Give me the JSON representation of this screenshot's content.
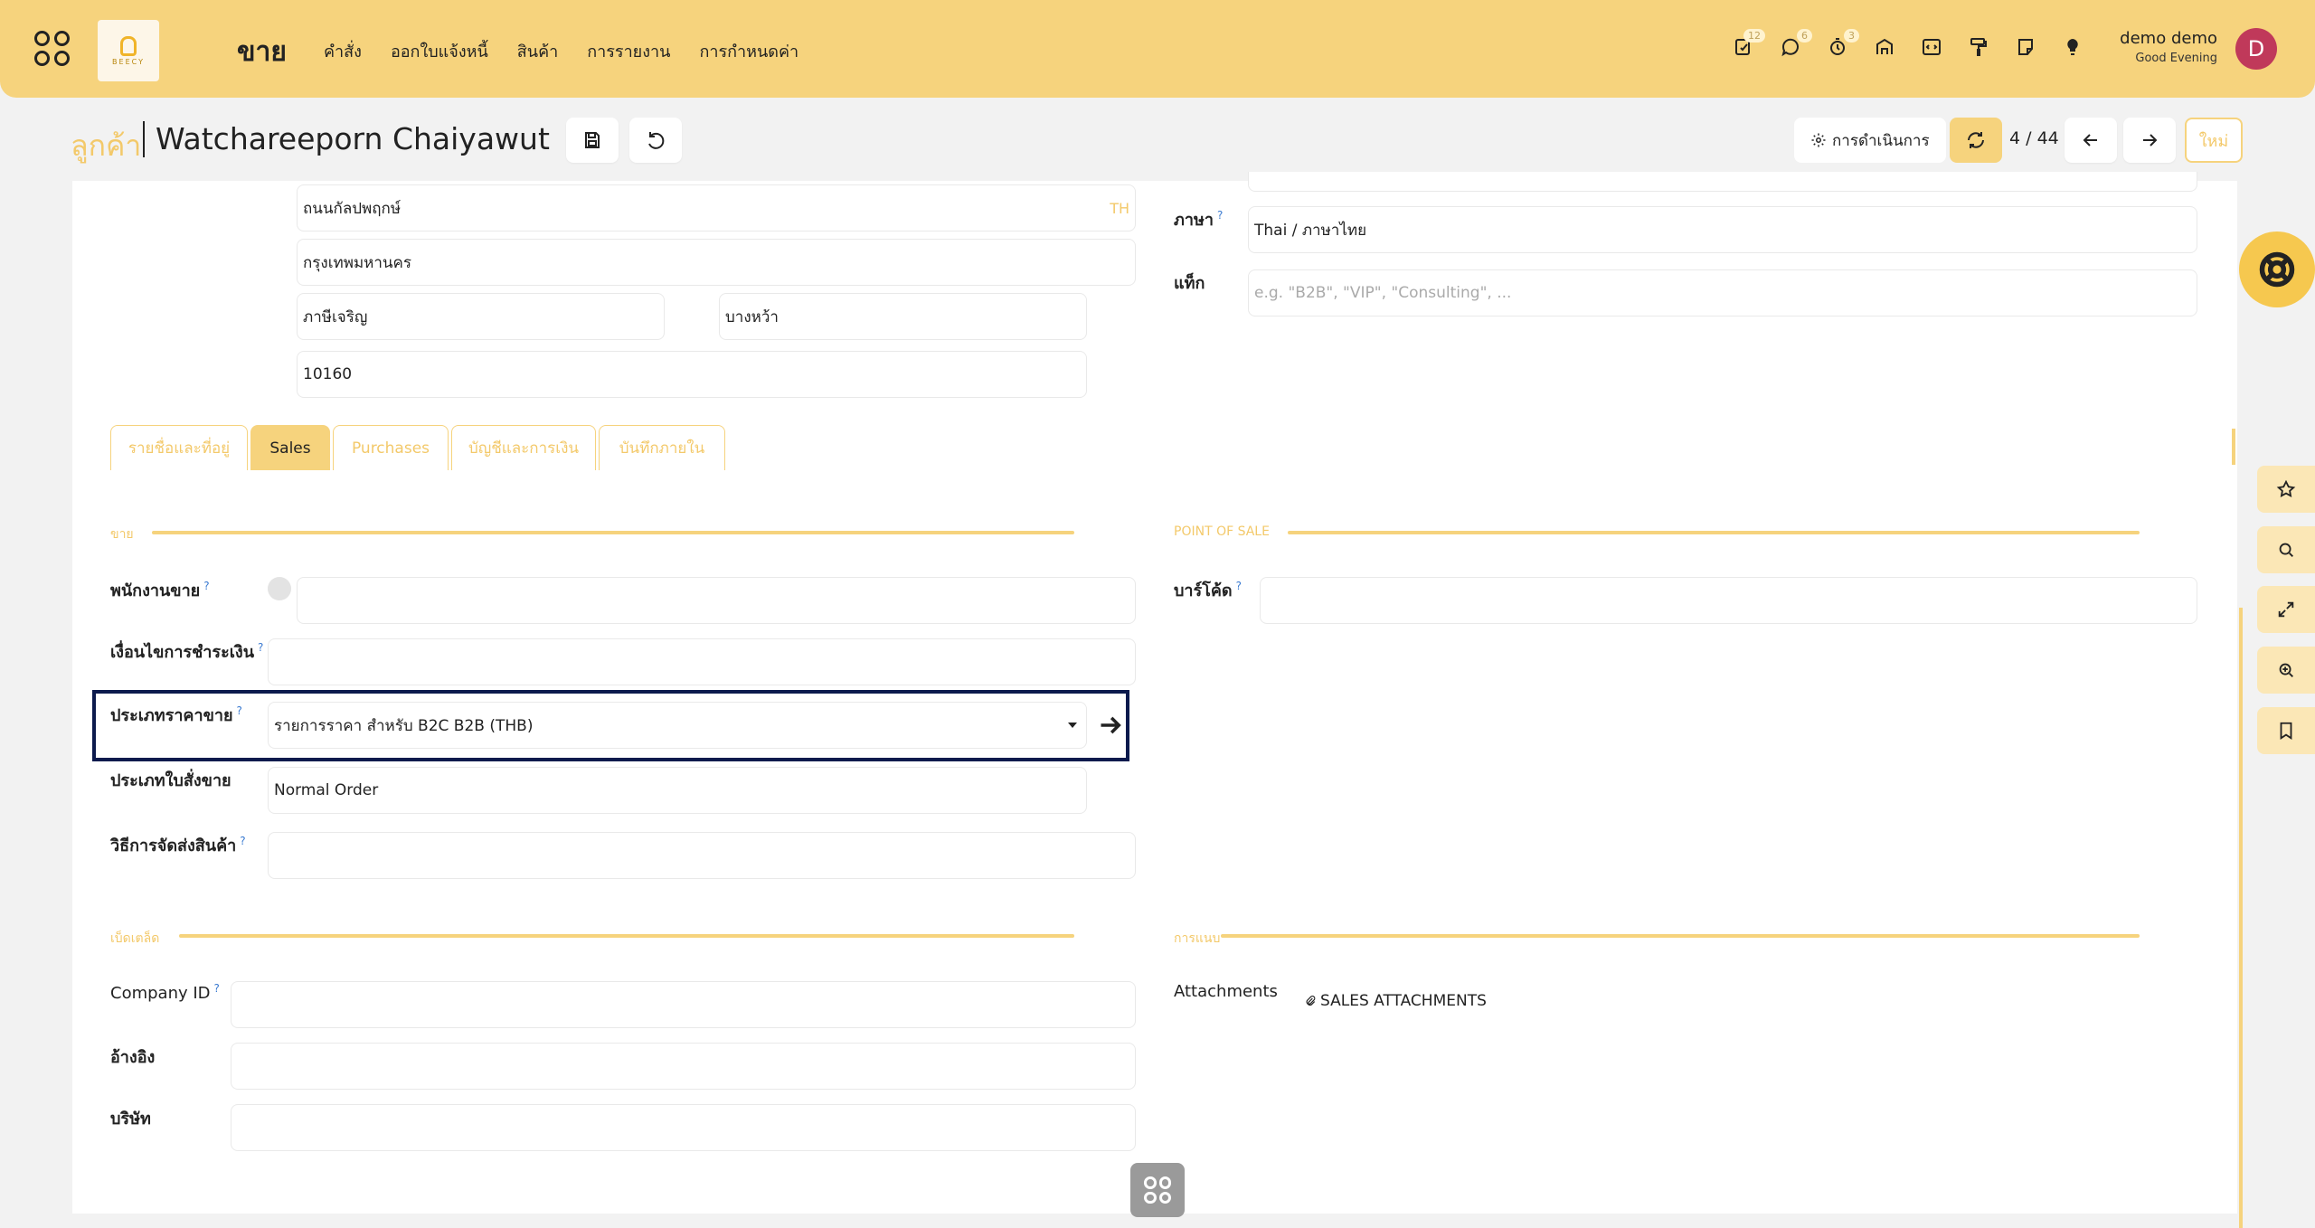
{
  "navbar": {
    "app_title": "ขาย",
    "logo_text": "BEECY",
    "menu": [
      "คำสั่ง",
      "ออกใบแจ้งหนี้",
      "สินค้า",
      "การรายงาน",
      "การกำหนดค่า"
    ],
    "badges": {
      "activities": "12",
      "messages": "6",
      "timer": "3"
    },
    "user_name": "demo demo",
    "greeting": "Good Evening",
    "avatar_letter": "D"
  },
  "breadcrumb": {
    "parent": "ลูกค้า",
    "current": "Watchareeporn Chaiyawut"
  },
  "controls": {
    "action_label": "การดำเนินการ",
    "pager": "4 / 44",
    "new_label": "ใหม่"
  },
  "address": {
    "street2": "ถนนกัลปพฤกษ์",
    "street2_lang": "TH",
    "city": "กรุงเทพมหานคร",
    "district": "ภาษีเจริญ",
    "subdistrict": "บางหว้า",
    "zip": "10160"
  },
  "right_top": {
    "language_label": "ภาษา",
    "language_value": "Thai / ภาษาไทย",
    "tags_label": "แท็ก",
    "tags_placeholder": "e.g. \"B2B\", \"VIP\", \"Consulting\", ..."
  },
  "tabs": [
    "รายชื่อและที่อยู่",
    "Sales",
    "Purchases",
    "บัญชีและการเงิน",
    "บันทึกภายใน"
  ],
  "sales_section": {
    "title": "ขาย",
    "salesperson_label": "พนักงานขาย",
    "payment_terms_label": "เงื่อนไขการชำระเงิน",
    "pricelist_label": "ประเภทราคาขาย",
    "pricelist_value": "รายการราคา สำหรับ B2C B2B (THB)",
    "order_type_label": "ประเภทใบสั่งขาย",
    "order_type_value": "Normal Order",
    "delivery_label": "วิธีการจัดส่งสินค้า"
  },
  "pos_section": {
    "title": "POINT OF SALE",
    "barcode_label": "บาร์โค้ด"
  },
  "misc_section": {
    "title": "เบ็ดเตล็ด",
    "company_id_label": "Company ID",
    "reference_label": "อ้างอิง",
    "company_label": "บริษัท"
  },
  "attach_section": {
    "title": "การแนบ",
    "attachments_label": "Attachments",
    "sales_attachments": "SALES ATTACHMENTS"
  },
  "colors": {
    "navbar": "#f6d37d",
    "accent_text": "#f3c96a",
    "help_text": "#3b7bd1",
    "highlight_border": "#0c1a4d",
    "avatar": "#c0395a"
  }
}
